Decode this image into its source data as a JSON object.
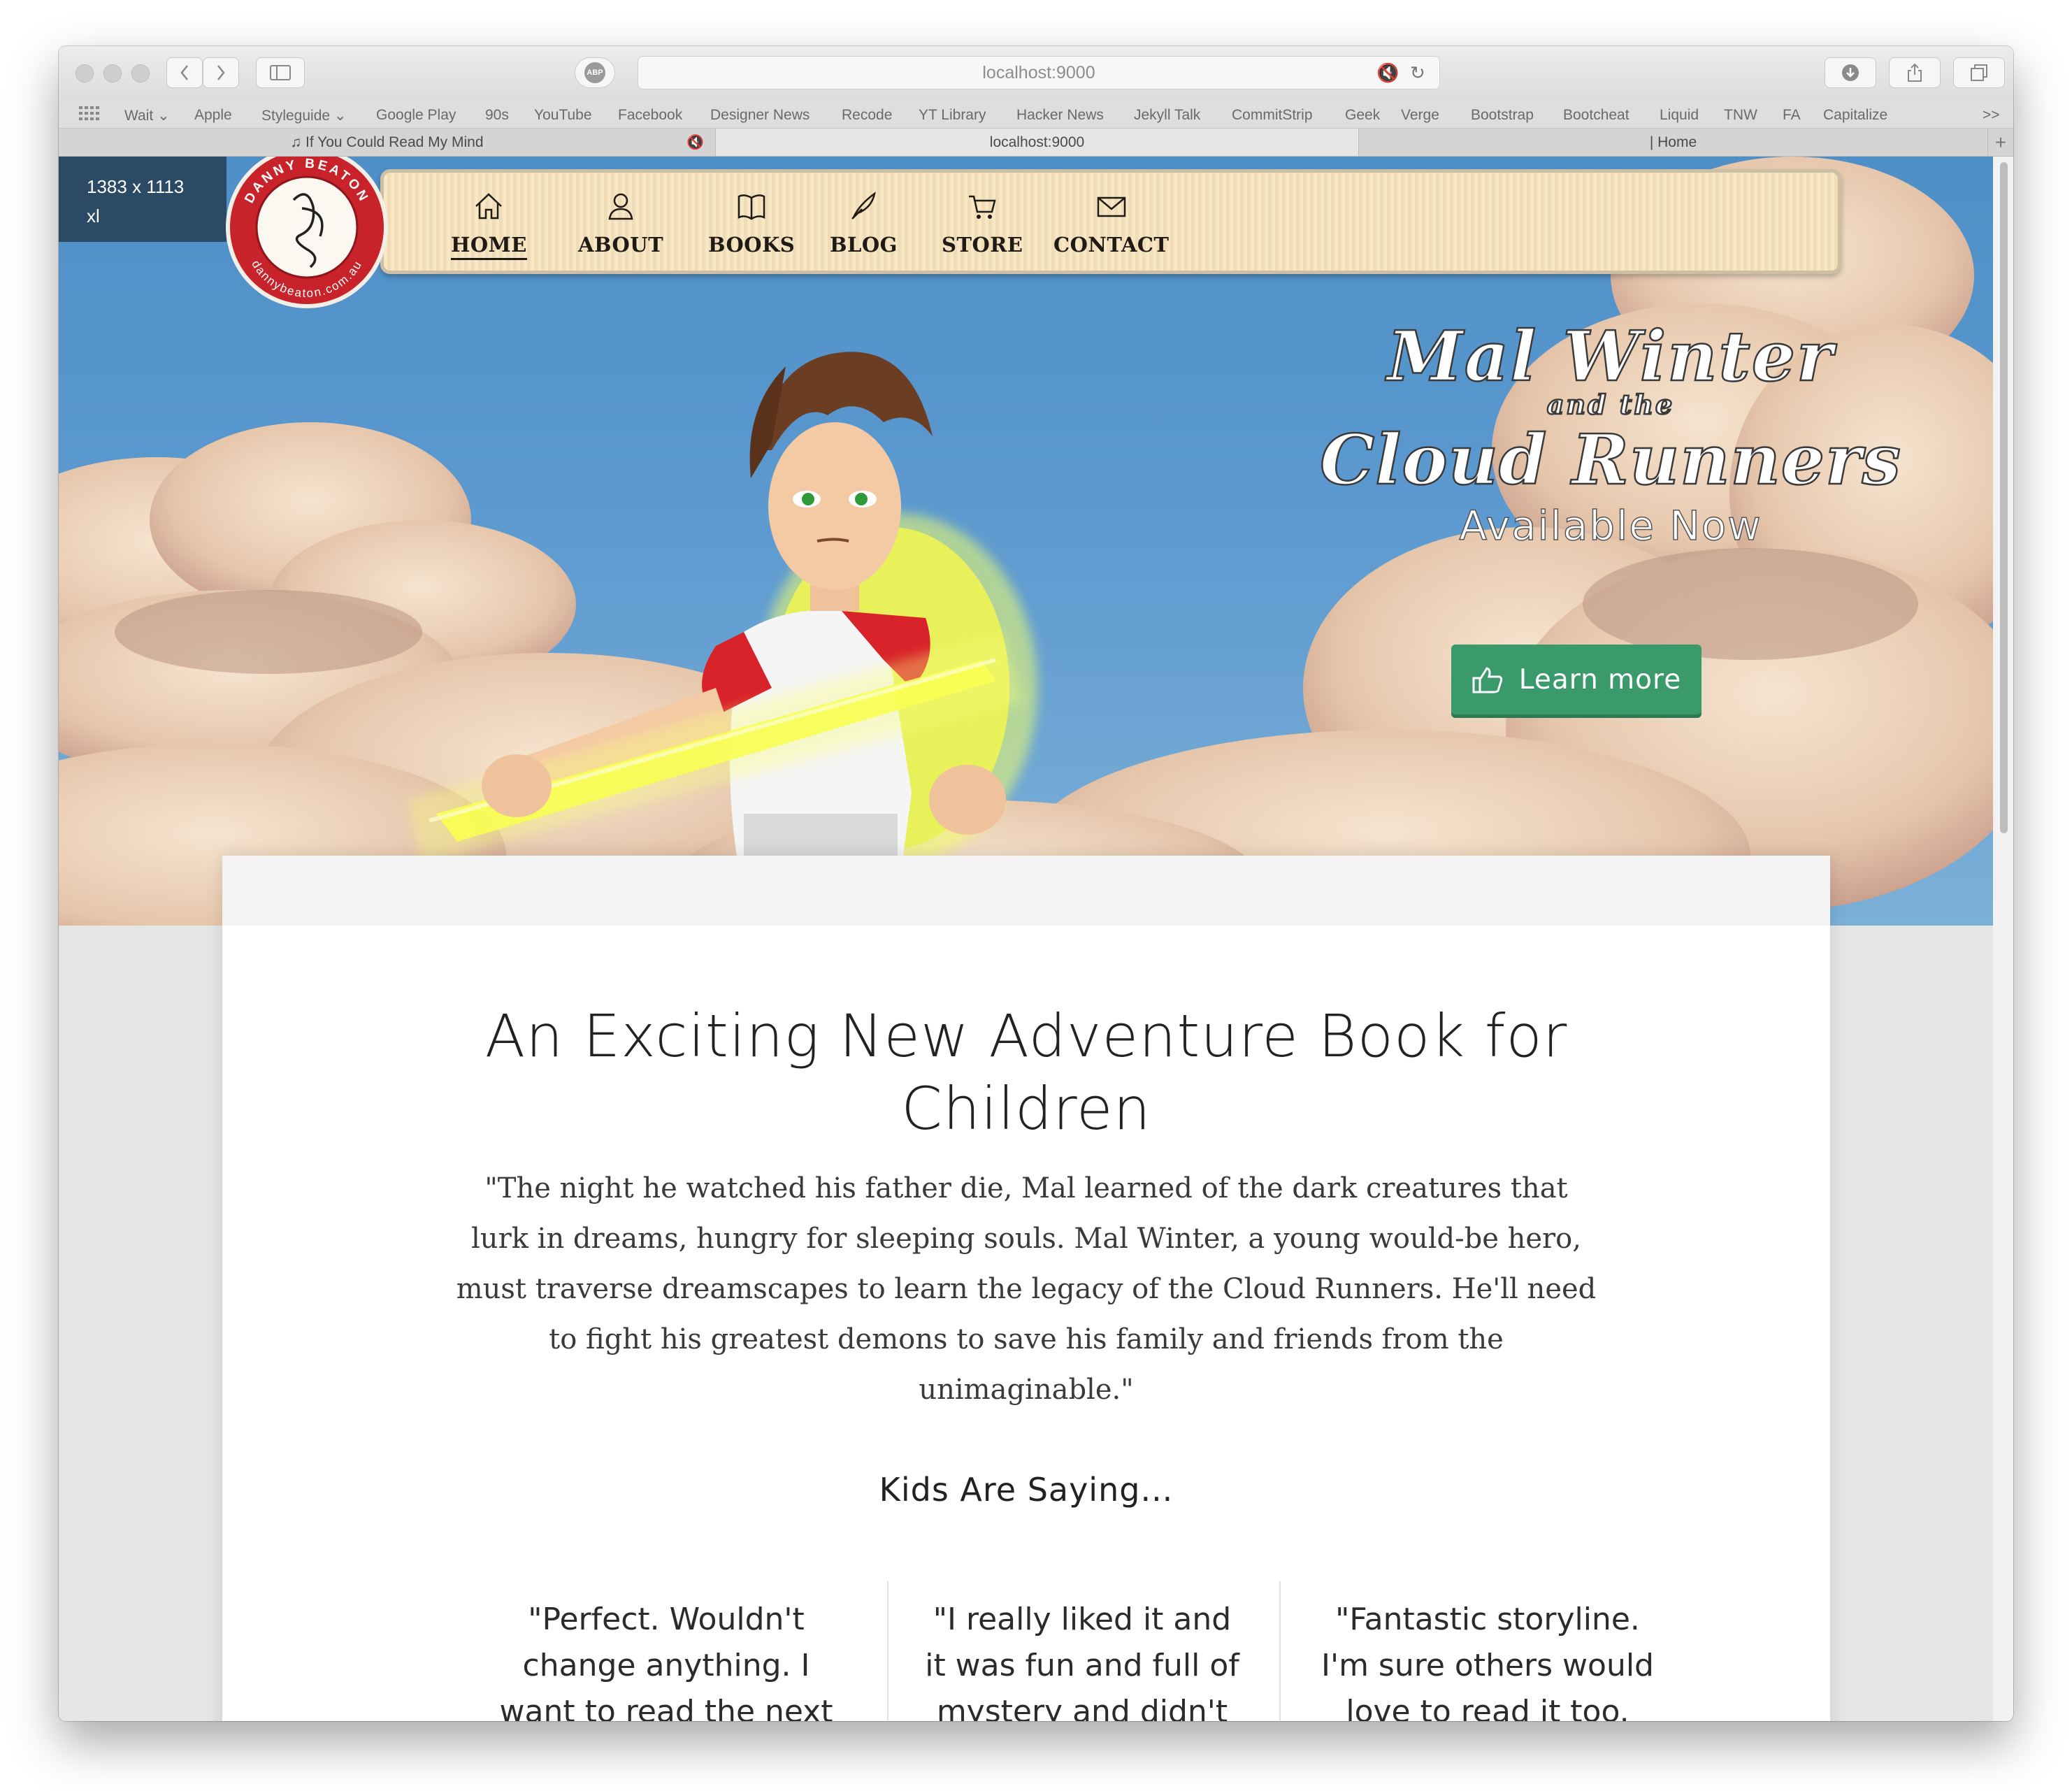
{
  "browser": {
    "address": "localhost:9000",
    "adblock_label": "ABP",
    "bookmarks": [
      "Wait",
      "Apple",
      "Styleguide",
      "Google Play",
      "90s",
      "YouTube",
      "Facebook",
      "Designer News",
      "Recode",
      "YT Library",
      "Hacker News",
      "Jekyll Talk",
      "CommitStrip",
      "Geek",
      "Verge",
      "Bootstrap",
      "Bootcheat",
      "Liquid",
      "TNW",
      "FA",
      "Capitalize"
    ],
    "bookmarks_overflow": ">>",
    "tabs": [
      {
        "label": "♫ If You Could Read My Mind"
      },
      {
        "label": "localhost:9000"
      },
      {
        "label": "| Home"
      }
    ],
    "new_tab": "+"
  },
  "overlay": {
    "size": "1383 x 1113",
    "breakpoint": "xl"
  },
  "logo": {
    "ring_top": "DANNY BEATON",
    "ring_bottom": "dannybeaton.com.au"
  },
  "nav": {
    "items": [
      {
        "label": "HOME",
        "icon": "home-icon"
      },
      {
        "label": "ABOUT",
        "icon": "user-icon"
      },
      {
        "label": "BOOKS",
        "icon": "book-icon"
      },
      {
        "label": "BLOG",
        "icon": "quill-icon"
      },
      {
        "label": "STORE",
        "icon": "cart-icon"
      },
      {
        "label": "CONTACT",
        "icon": "envelope-icon"
      }
    ]
  },
  "hero": {
    "title_line1": "Mal Winter",
    "title_line2": "and the",
    "title_line3": "Cloud Runners",
    "tagline": "Available Now",
    "cta": "Learn more"
  },
  "main": {
    "headline_line1": "An Exciting New Adventure Book for",
    "headline_line2": "Children",
    "blurb": "\"The night he watched his father die, Mal learned of the dark creatures that lurk in dreams, hungry for sleeping souls. Mal Winter, a young would-be hero, must traverse dreamscapes to learn the legacy of the Cloud Runners. He'll need to fight his greatest demons to save his family and friends from the unimaginable.\"",
    "testimonials_title": "Kids Are Saying...",
    "testimonials": [
      "\"Perfect. Wouldn't change anything. I want to read the next one.\"",
      "\"I really liked it and it was fun and full of mystery and didn't",
      "\"Fantastic storyline. I'm sure others would love to read it too. Great"
    ]
  },
  "colors": {
    "accent": "#3a9a6c",
    "nav_bg": "#f7e7c6",
    "logo_red": "#c8232b",
    "sky": "#5b99cf"
  }
}
